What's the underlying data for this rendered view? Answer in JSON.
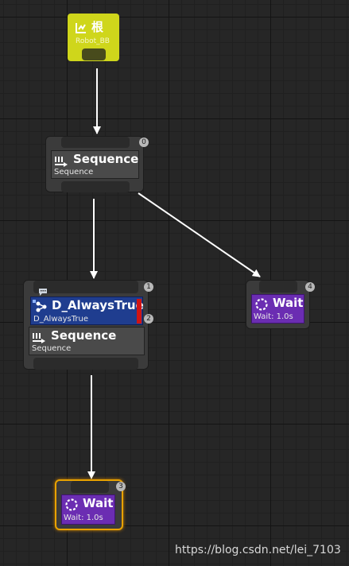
{
  "root": {
    "title": "根",
    "subtitle": "Robot_BB",
    "icon": "root-graph-icon"
  },
  "sequence_top": {
    "index": "0",
    "title": "Sequence",
    "subtitle": "Sequence",
    "icon": "sequence-icon"
  },
  "sequence_mid": {
    "index": "1",
    "decorator": {
      "index": "2",
      "title": "D_AlwaysTrue",
      "subtitle": "D_AlwaysTrue",
      "icon": "decorator-icon",
      "color": "#1f3d8f"
    },
    "title": "Sequence",
    "subtitle": "Sequence",
    "icon": "sequence-icon",
    "comment_icon": "comment-icon"
  },
  "wait_right": {
    "index": "4",
    "title": "Wait",
    "subtitle": "Wait: 1.0s",
    "icon": "wait-icon",
    "color": "#6b2db2"
  },
  "wait_bottom": {
    "index": "3",
    "title": "Wait",
    "subtitle": "Wait: 1.0s",
    "icon": "wait-icon",
    "color": "#6b2db2",
    "selected": true,
    "selection_color": "#e8a200"
  },
  "watermark": "https://blog.csdn.net/lei_7103"
}
